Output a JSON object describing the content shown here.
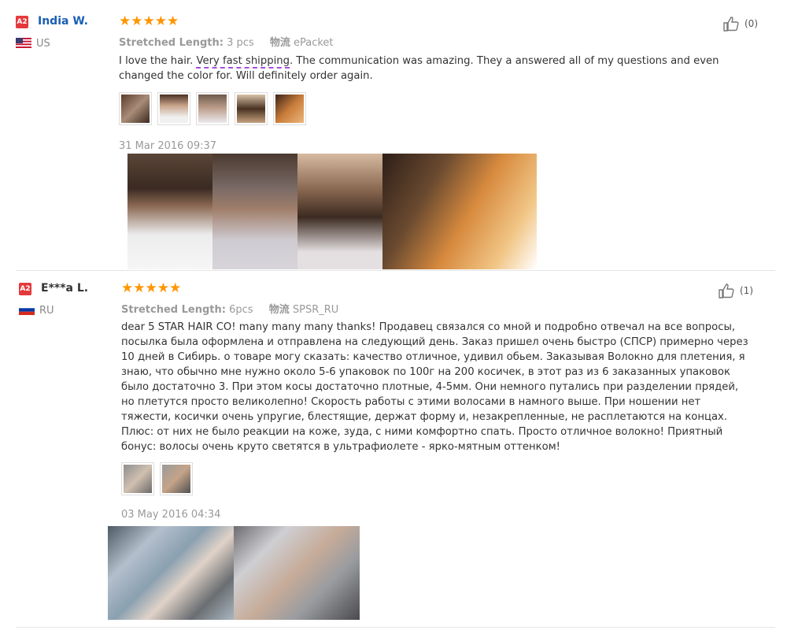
{
  "reviews": [
    {
      "badge": "A2",
      "name": "India W.",
      "country": "US",
      "stars": "★★★★★",
      "length_label": "Stretched Length:",
      "length_value": "3 pcs",
      "logistics_label": "物流",
      "logistics_value": "ePacket",
      "text_before": "I love the hair. ",
      "text_highlight": "Very fast shipping",
      "text_after": ". The communication was amazing. They a answered all of my questions and even changed the color for. Will definitely order again.",
      "date": "31 Mar 2016 09:37",
      "likes": "(0)"
    },
    {
      "badge": "A2",
      "name": "E***a L.",
      "country": "RU",
      "stars": "★★★★★",
      "length_label": "Stretched Length:",
      "length_value": "6pcs",
      "logistics_label": "物流",
      "logistics_value": "SPSR_RU",
      "text": "dear 5 STAR HAIR CO! many many many thanks! Продавец связался со мной и подробно отвечал на все вопросы, посылка была оформлена и отправлена на следующий день. Заказ пришел очень быстро (СПСР) примерно через 10 дней в Сибирь. о товаре могу сказать: качество отличное, удивил обьем. Заказывая Волокно для плетения, я знаю, что обычно мне нужно около 5-6 упаковок по 100г на 200 косичек, в этот раз из 6 заказанных упаковок было достаточно 3. При этом косы достаточно плотные, 4-5мм. Они немного путались при разделении прядей, но плетутся просто великолепно! Скорость работы с этими волосами в намного выше. При ношении нет тяжести, косички очень упругие, блестящие, держат форму и, незакрепленные, не расплетаются на концах. Плюс: от них не было реакции на коже, зуда, с ними комфортно спать. Просто отличное волокно! Приятный бонус: волосы очень круто светятся в ультрафиолете - ярко-мятным оттенком!",
      "date": "03 May 2016 04:34",
      "likes": "(1)"
    }
  ],
  "colors": {
    "star": "#ff9500",
    "name": "#1a5fb4",
    "badge": "#e4393c",
    "highlight_underline": "#a64ddb"
  },
  "icons": [
    "thumbs-up-icon",
    "us-flag-icon",
    "ru-flag-icon"
  ]
}
